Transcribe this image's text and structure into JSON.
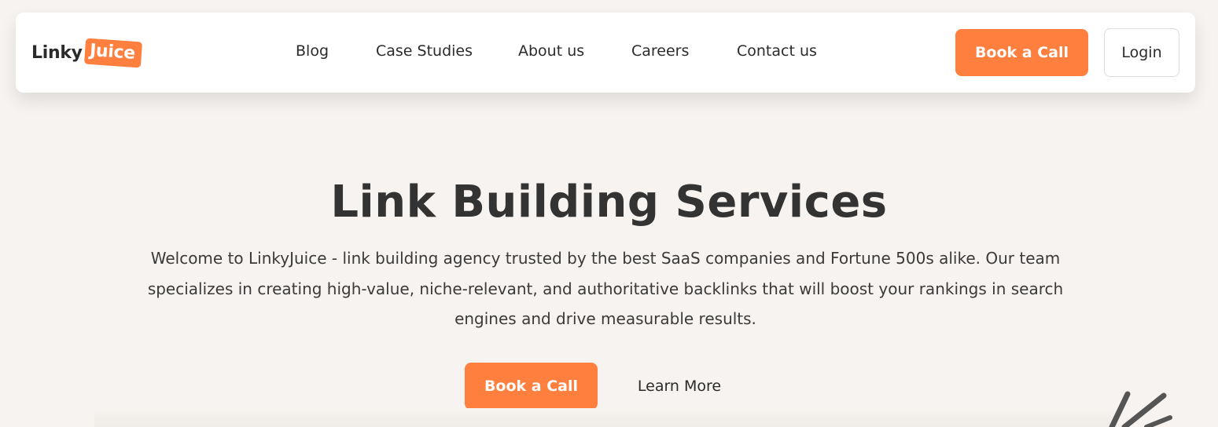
{
  "brand": {
    "logo_part1": "Linky",
    "logo_part2": "Juice",
    "accent_color": "#ff7f3f"
  },
  "nav": {
    "links": [
      "Blog",
      "Case Studies",
      "About us",
      "Careers",
      "Contact us"
    ],
    "book_call": "Book a Call",
    "login": "Login"
  },
  "hero": {
    "title": "Link Building Services",
    "description": "Welcome to LinkyJuice - link building agency trusted by the best SaaS companies and Fortune 500s alike. Our team specializes in creating high-value, niche-relevant, and authoritative backlinks that will boost your rankings in search engines and drive measurable results.",
    "primary_cta": "Book a Call",
    "secondary_cta": "Learn More"
  },
  "decoration": {
    "icon": "hand-drawn-strokes"
  }
}
